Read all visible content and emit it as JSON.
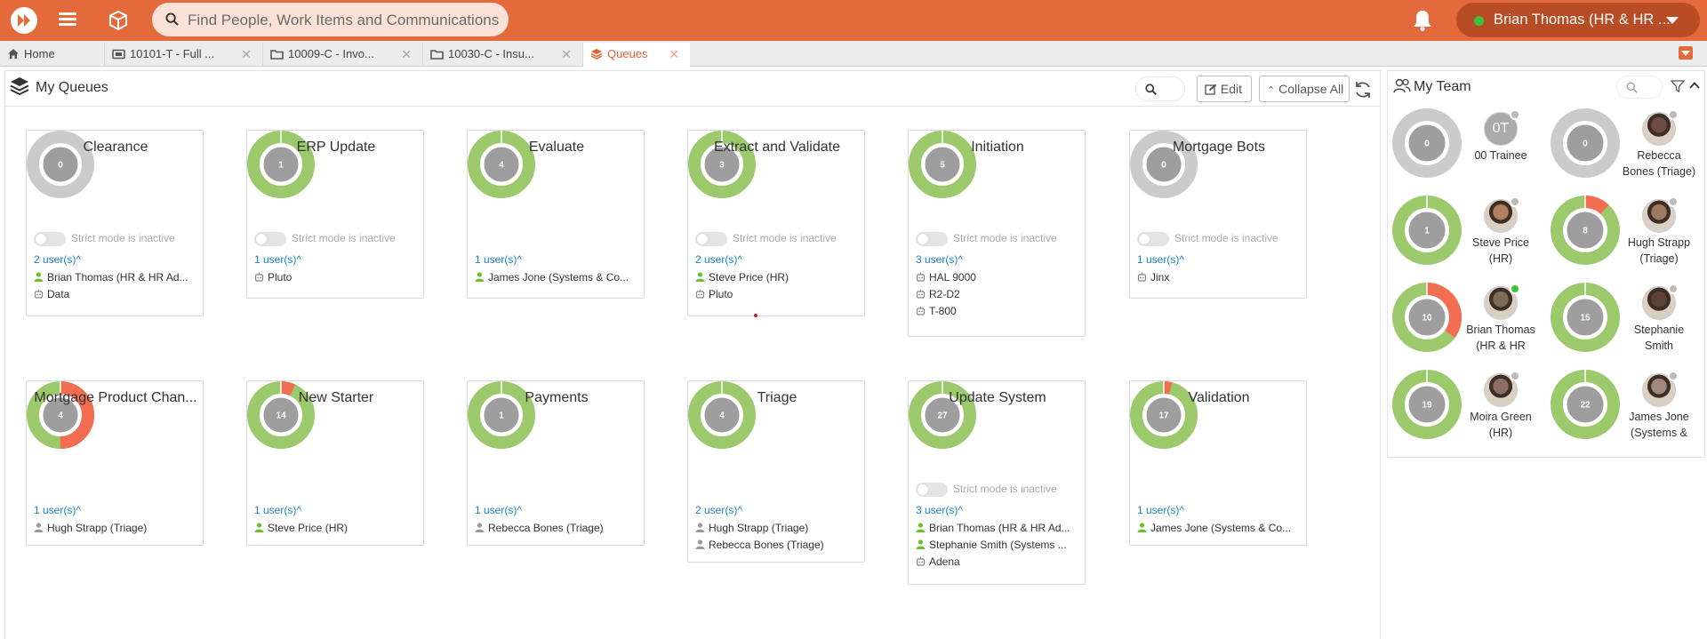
{
  "topbar": {
    "search_placeholder": "Find People, Work Items and Communications",
    "user_name": "Brian Thomas (HR & HR ...",
    "colors": {
      "bar": "#e46a3b",
      "pill": "#b84c24",
      "online": "#3cc33c"
    }
  },
  "tabs": [
    {
      "label": "Home",
      "icon": "home-icon",
      "closable": false
    },
    {
      "label": "10101-T - Full ...",
      "icon": "ticket-icon",
      "closable": true
    },
    {
      "label": "10009-C - Invo...",
      "icon": "folder-icon",
      "closable": true
    },
    {
      "label": "10030-C - Insu...",
      "icon": "folder-icon",
      "closable": true
    },
    {
      "label": "Queues",
      "icon": "layers-icon",
      "closable": true,
      "active": true
    }
  ],
  "queues_panel": {
    "title": "My Queues",
    "edit_label": "Edit",
    "collapse_label": "Collapse All"
  },
  "queues": [
    {
      "name": "Clearance",
      "count": "0",
      "green": 0,
      "red": 0,
      "strict": "Strict mode is inactive",
      "users": "2 user(s)",
      "members": [
        {
          "name": "Brian Thomas (HR & HR Ad...",
          "kind": "person-green"
        },
        {
          "name": "Data",
          "kind": "robot"
        }
      ]
    },
    {
      "name": "ERP Update",
      "count": "1",
      "green": 1,
      "red": 0,
      "strict": "Strict mode is inactive",
      "users": "1 user(s)",
      "members": [
        {
          "name": "Pluto",
          "kind": "robot"
        }
      ]
    },
    {
      "name": "Evaluate",
      "count": "4",
      "green": 1,
      "red": 0,
      "strict": "",
      "users": "1 user(s)",
      "members": [
        {
          "name": "James Jone (Systems & Co...",
          "kind": "person-green"
        }
      ]
    },
    {
      "name": "Extract and Validate",
      "count": "3",
      "green": 1,
      "red": 0,
      "strict": "Strict mode is inactive",
      "users": "2 user(s)",
      "members": [
        {
          "name": "Steve Price (HR)",
          "kind": "person-green"
        },
        {
          "name": "Pluto",
          "kind": "robot"
        }
      ]
    },
    {
      "name": "Initiation",
      "count": "5",
      "green": 1,
      "red": 0,
      "strict": "Strict mode is inactive",
      "users": "3 user(s)",
      "members": [
        {
          "name": "HAL 9000",
          "kind": "robot"
        },
        {
          "name": "R2-D2",
          "kind": "robot"
        },
        {
          "name": "T-800",
          "kind": "robot"
        }
      ]
    },
    {
      "name": "Mortgage Bots",
      "count": "0",
      "green": 0,
      "red": 0,
      "strict": "Strict mode is inactive",
      "users": "1 user(s)",
      "members": [
        {
          "name": "Jinx",
          "kind": "robot"
        }
      ]
    },
    {
      "name": "Mortgage Product Chan...",
      "count": "4",
      "green": 0.5,
      "red": 0.5,
      "strict": "",
      "users": "1 user(s)",
      "members": [
        {
          "name": "Hugh Strapp (Triage)",
          "kind": "person-grey"
        }
      ]
    },
    {
      "name": "New Starter",
      "count": "14",
      "green": 0.93,
      "red": 0.07,
      "strict": "",
      "users": "1 user(s)",
      "members": [
        {
          "name": "Steve Price (HR)",
          "kind": "person-green"
        }
      ]
    },
    {
      "name": "Payments",
      "count": "1",
      "green": 1,
      "red": 0,
      "strict": "",
      "users": "1 user(s)",
      "members": [
        {
          "name": "Rebecca Bones (Triage)",
          "kind": "person-grey"
        }
      ]
    },
    {
      "name": "Triage",
      "count": "4",
      "green": 1,
      "red": 0,
      "strict": "",
      "users": "2 user(s)",
      "members": [
        {
          "name": "Hugh Strapp (Triage)",
          "kind": "person-grey"
        },
        {
          "name": "Rebecca Bones (Triage)",
          "kind": "person-grey"
        }
      ]
    },
    {
      "name": "Update System",
      "count": "27",
      "green": 1,
      "red": 0,
      "strict": "Strict mode is inactive",
      "users": "3 user(s)",
      "members": [
        {
          "name": "Brian Thomas (HR & HR Ad...",
          "kind": "person-green"
        },
        {
          "name": "Stephanie Smith (Systems ...",
          "kind": "person-green"
        },
        {
          "name": "Adena",
          "kind": "robot"
        }
      ]
    },
    {
      "name": "Validation",
      "count": "17",
      "green": 0.96,
      "red": 0.04,
      "strict": "",
      "users": "1 user(s)",
      "members": [
        {
          "name": "James Jone (Systems & Co...",
          "kind": "person-green"
        }
      ]
    }
  ],
  "team_panel": {
    "title": "My Team"
  },
  "team": [
    {
      "count": "0",
      "green": 0,
      "red": 0,
      "name_lines": [
        "00 Trainee"
      ],
      "avatar": "initials",
      "initials": "0T",
      "status": "#bbbbbb"
    },
    {
      "count": "0",
      "green": 0,
      "red": 0,
      "name_lines": [
        "Rebecca",
        "Bones (Triage)"
      ],
      "avatar": "photo",
      "status": "#bbbbbb"
    },
    {
      "count": "1",
      "green": 1,
      "red": 0,
      "name_lines": [
        "Steve Price",
        "(HR)"
      ],
      "avatar": "photo",
      "status": "#bbbbbb"
    },
    {
      "count": "8",
      "green": 0.88,
      "red": 0.12,
      "name_lines": [
        "Hugh Strapp",
        "(Triage)"
      ],
      "avatar": "photo",
      "status": "#bbbbbb"
    },
    {
      "count": "10",
      "green": 0.65,
      "red": 0.35,
      "name_lines": [
        "Brian Thomas",
        "(HR & HR"
      ],
      "avatar": "photo",
      "status": "#3cc33c"
    },
    {
      "count": "15",
      "green": 1,
      "red": 0,
      "name_lines": [
        "Stephanie",
        "Smith"
      ],
      "avatar": "photo",
      "status": "#bbbbbb"
    },
    {
      "count": "19",
      "green": 1,
      "red": 0,
      "name_lines": [
        "Moira Green",
        "(HR)"
      ],
      "avatar": "photo",
      "status": "#bbbbbb"
    },
    {
      "count": "22",
      "green": 1,
      "red": 0,
      "name_lines": [
        "James Jone",
        "(Systems &"
      ],
      "avatar": "photo",
      "status": "#bbbbbb"
    }
  ],
  "donut_colors": {
    "green": "#9cc96b",
    "red": "#f26d52",
    "grey": "#cbcbcb",
    "center": "#9e9e9e"
  }
}
